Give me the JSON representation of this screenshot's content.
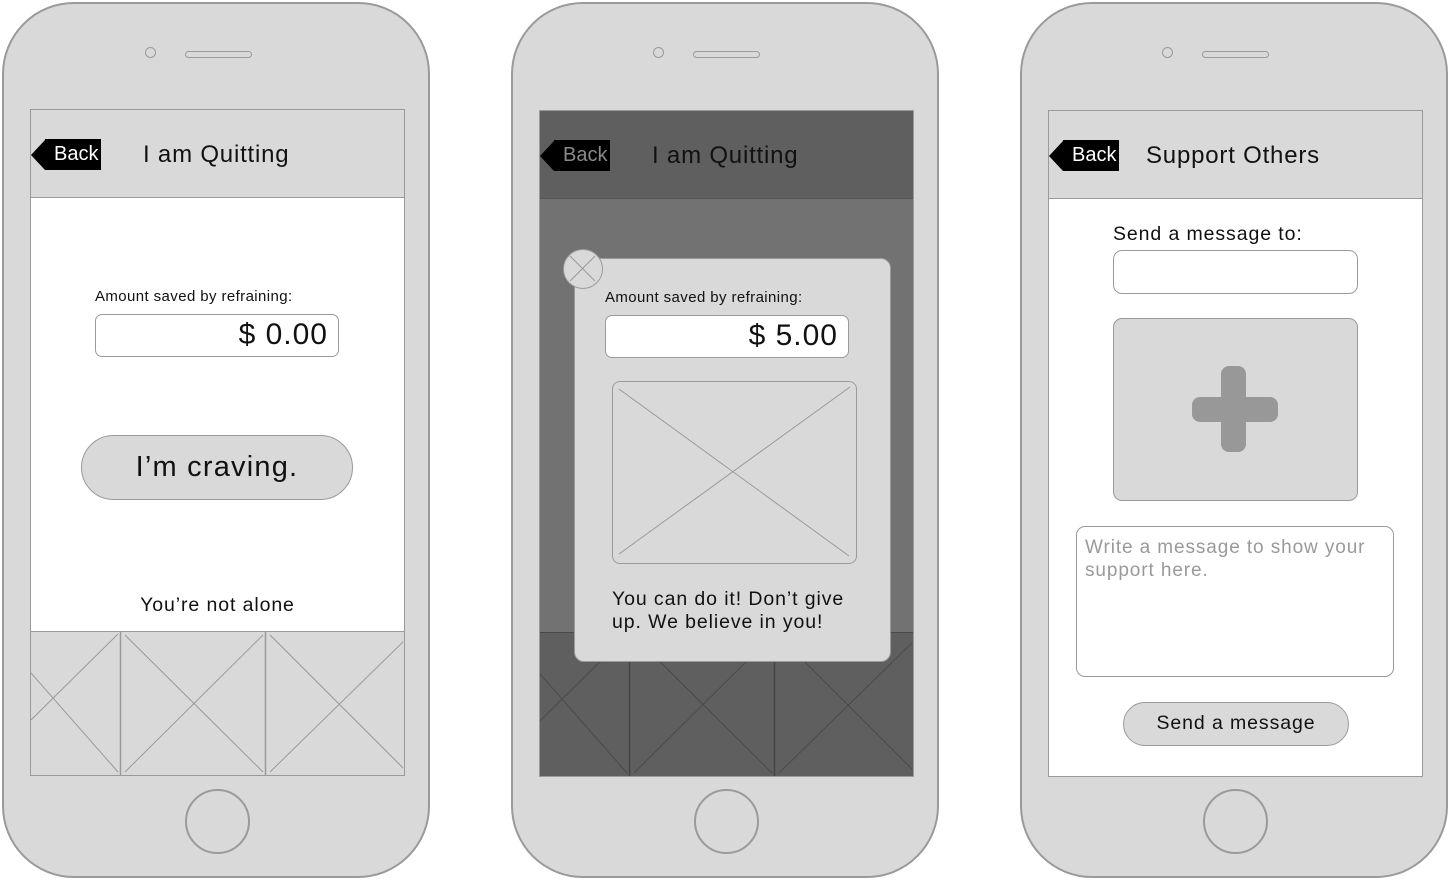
{
  "screens": [
    {
      "id": "quit-home",
      "back_label": "Back",
      "title": "I am Quitting",
      "amount_label": "Amount saved by refraining:",
      "amount_value": "$ 0.00",
      "craving_button": "I’m craving.",
      "community_heading": "You’re not alone",
      "gallery_icon": "image-placeholder-icon"
    },
    {
      "id": "quit-craving-popup",
      "back_label": "Back",
      "title": "I am Quitting",
      "popup": {
        "close_icon": "close-circle-icon",
        "amount_label": "Amount saved by refraining:",
        "amount_value": "$ 5.00",
        "image_icon": "image-placeholder-icon",
        "message": "You can do it! Don’t give up. We believe in you!"
      }
    },
    {
      "id": "support-others",
      "back_label": "Back",
      "title": "Support Others",
      "recipient_label": "Send a message to:",
      "recipient_value": "",
      "add_photo_icon": "plus-icon",
      "message_placeholder": "Write a message to show your support here.",
      "message_value": "",
      "send_button": "Send a message"
    }
  ],
  "colors": {
    "device_body": "#d9d9d9",
    "device_outline": "#9a9a9a",
    "back_badge": "#000000",
    "overlay_dim": "#727272",
    "overlay_dark": "#5f5f5f"
  }
}
